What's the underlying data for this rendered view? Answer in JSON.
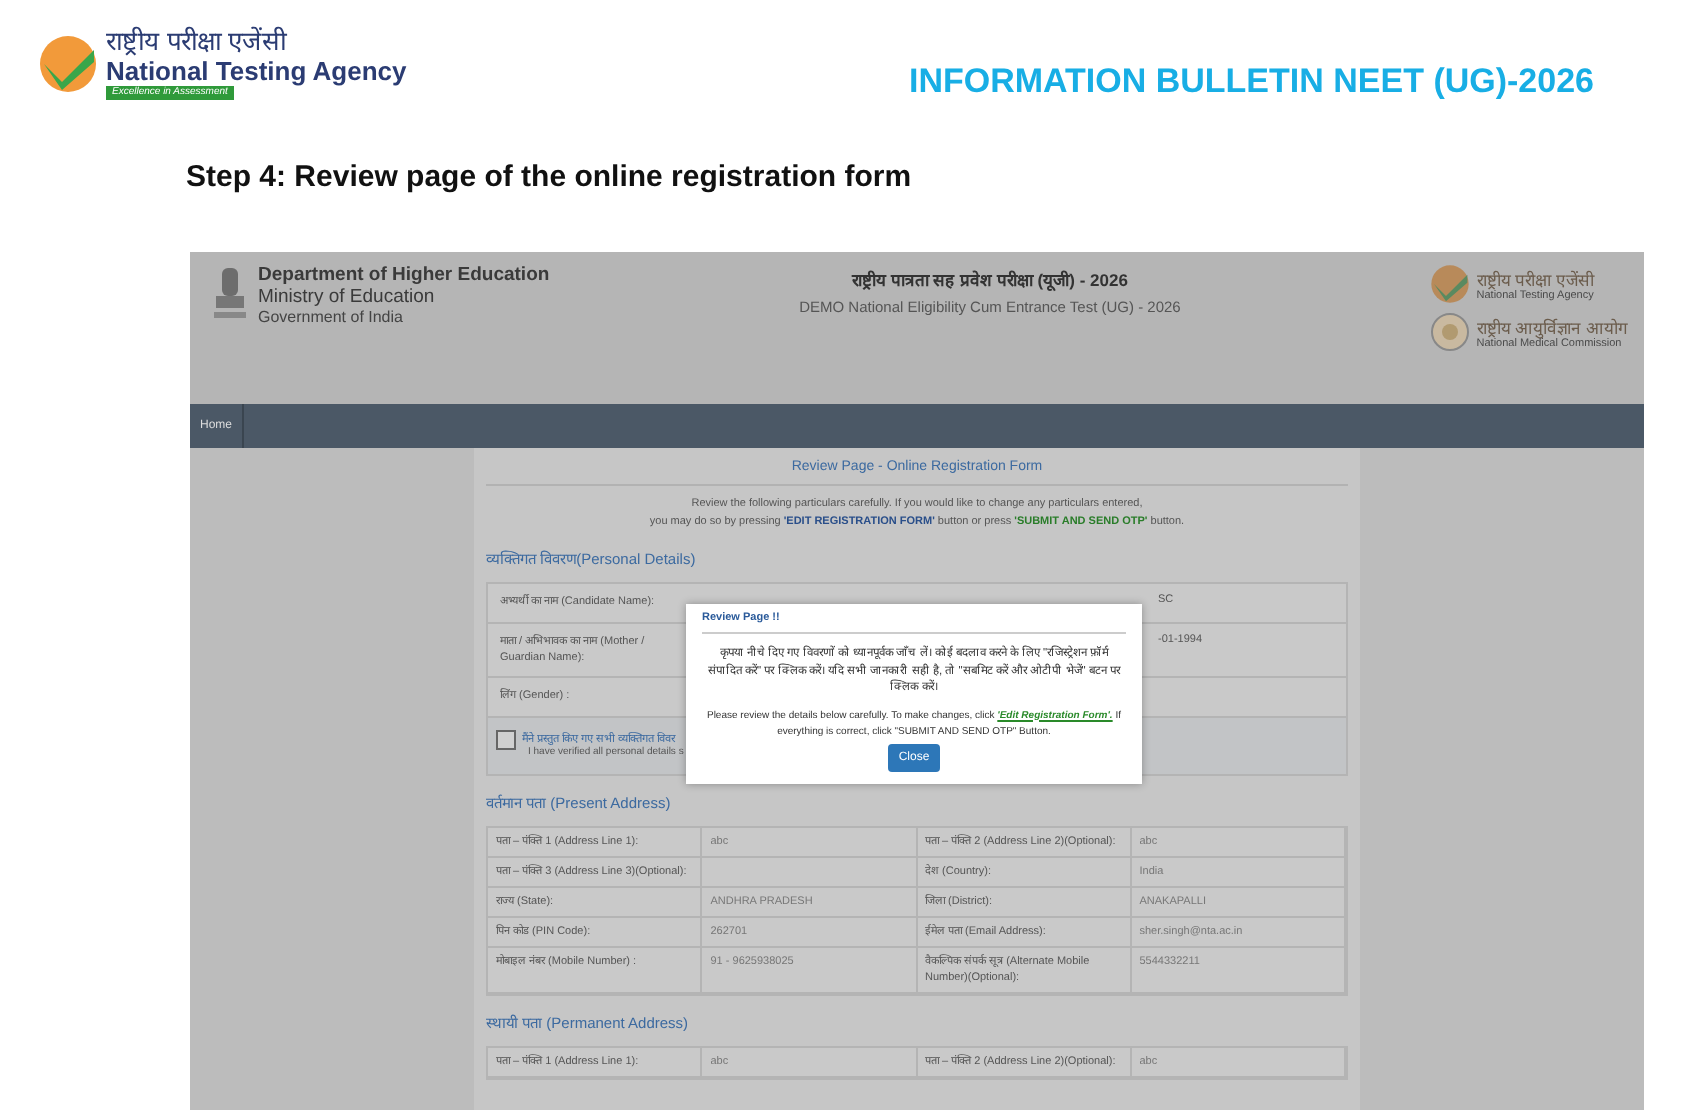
{
  "bulletin": {
    "org_hindi": "राष्ट्रीय परीक्षा एजेंसी",
    "org_name": "National Testing Agency",
    "tagline": "Excellence in Assessment",
    "title": "INFORMATION BULLETIN NEET (UG)-2026",
    "step_heading": "Step 4: Review page of the online registration form"
  },
  "portal": {
    "dept": "Department of Higher Education",
    "ministry": "Ministry of Education",
    "govt": "Government of India",
    "title_hindi": "राष्ट्रीय पात्रता सह प्रवेश परीक्षा (यूजी) - 2026",
    "title": "DEMO National Eligibility Cum Entrance Test (UG) - 2026",
    "nta_hindi": "राष्ट्रीय परीक्षा एजेंसी",
    "nta": "National Testing Agency",
    "nmc_hindi": "राष्ट्रीय आयुर्विज्ञान आयोग",
    "nmc": "National Medical Commission",
    "nav": [
      {
        "label": "Home",
        "selected": false
      }
    ]
  },
  "form": {
    "title": "Review Page - Online Registration Form",
    "intro_line1": "Review the following particulars carefully. If you would like to change any particulars entered,",
    "intro_before": "you may do so by pressing ",
    "intro_edit": "'EDIT REGISTRATION FORM'",
    "intro_middle": " button or press ",
    "intro_submit": "'SUBMIT AND SEND OTP'",
    "intro_after": " button.",
    "personal_heading": "व्यक्तिगत विवरण(Personal Details)",
    "personal_rows": [
      {
        "label": "अभ्यर्थी का नाम (Candidate Name):",
        "value": "SC"
      },
      {
        "label": "माता / अभिभावक का नाम (Mother / Guardian Name):",
        "value": "-01-1994"
      },
      {
        "label": "लिंग (Gender) :",
        "value": ""
      }
    ],
    "declaration": {
      "checked": false,
      "hindi": "मैंने प्रस्तुत किए गए सभी व्यक्तिगत विवर",
      "english": "I have verified all personal details s"
    },
    "sections": [
      {
        "heading": "वर्तमान पता (Present Address)",
        "rows": [
          [
            "पता – पंक्ति 1 (Address Line 1):",
            "abc",
            "पता – पंक्ति 2 (Address Line 2)(Optional):",
            "abc"
          ],
          [
            "पता – पंक्ति 3 (Address Line 3)(Optional):",
            "",
            "देश (Country):",
            "India"
          ],
          [
            "राज्य (State):",
            "ANDHRA PRADESH",
            "जिला (District):",
            "ANAKAPALLI"
          ],
          [
            "पिन कोड (PIN Code):",
            "262701",
            "ईमेल पता (Email Address):",
            "sher.singh@nta.ac.in"
          ],
          [
            "मोबाइल नंबर (Mobile Number) :",
            "91 - 9625938025",
            "वैकल्पिक संपर्क सूत्र (Alternate Mobile Number)(Optional):",
            "5544332211"
          ]
        ]
      },
      {
        "heading": "स्थायी पता (Permanent Address)",
        "rows": [
          [
            "पता – पंक्ति 1 (Address Line 1):",
            "abc",
            "पता – पंक्ति 2 (Address Line 2)(Optional):",
            "abc"
          ]
        ]
      }
    ]
  },
  "modal": {
    "title": "Review Page !!",
    "hindi": "कृपया नीचे दिए गए विवरणों को ध्यानपूर्वक जाँच लें। कोई बदलाव करने के लिए \"रजिस्ट्रेशन फ़ॉर्म संपादित करें\" पर क्लिक करें। यदि सभी जानकारी सही है, तो \"सबमिट करें और ओटीपी भेजें\" बटन पर क्लिक करें।",
    "english_before": "Please review the details below carefully. To make changes, click ",
    "link": "'Edit Registration Form'.",
    "english_after": " If everything is correct, click \"SUBMIT AND SEND OTP\" Button.",
    "close": "Close"
  }
}
